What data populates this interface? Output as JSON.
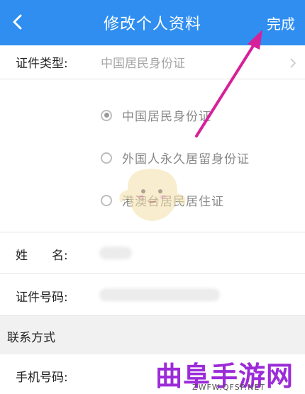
{
  "header": {
    "title": "修改个人资料",
    "done_label": "完成",
    "background": "#2f8ef0"
  },
  "id_type": {
    "label": "证件类型:",
    "value": "中国居民身份证",
    "options": [
      {
        "label": "中国居民身份证",
        "selected": true
      },
      {
        "label": "外国人永久居留身份证",
        "selected": false
      },
      {
        "label": "港澳台居民居住证",
        "selected": false
      }
    ]
  },
  "name_row": {
    "label": "姓　　名:"
  },
  "id_number_row": {
    "label": "证件号码:"
  },
  "contact_section": {
    "title": "联系方式"
  },
  "phone_row": {
    "label": "手机号码:"
  },
  "watermark": {
    "brand": "曲阜手游网",
    "domain": "ZWFW.QFSP.NET"
  },
  "colors": {
    "accent": "#2f8ef0",
    "annotation_arrow": "#d6219a",
    "watermark": "#9c2bd8"
  }
}
